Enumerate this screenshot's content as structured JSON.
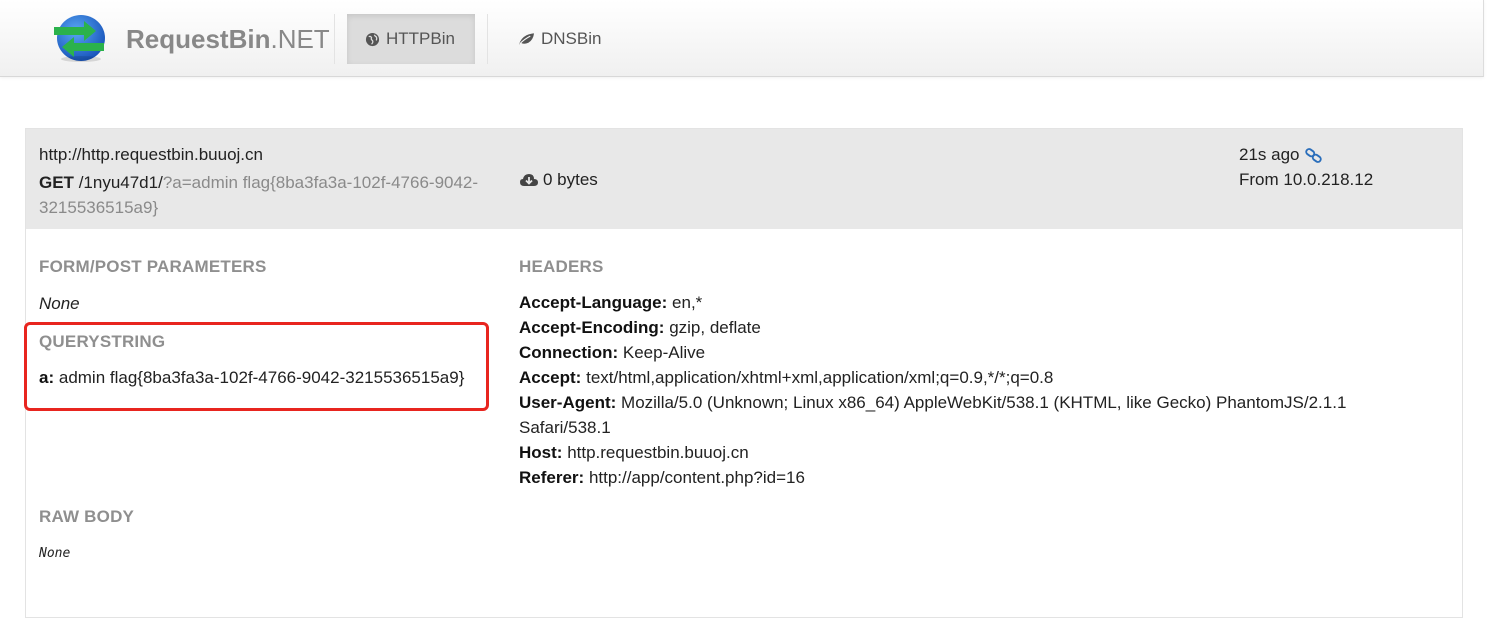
{
  "navbar": {
    "brand_bold": "RequestBin",
    "brand_suffix": ".NET",
    "nav_items": [
      {
        "label": "HTTPBin",
        "icon": "globe-icon",
        "active": true
      },
      {
        "label": "DNSBin",
        "icon": "leaf-icon",
        "active": false
      }
    ]
  },
  "request": {
    "host_url": "http://http.requestbin.buuoj.cn",
    "method": "GET",
    "path": "/1nyu47d1/",
    "query": "?a=admin flag{8ba3fa3a-102f-4766-9042-3215536515a9}",
    "size": "0 bytes",
    "time_ago": "21s ago",
    "from": "From 10.0.218.12"
  },
  "form_params": {
    "title": "FORM/POST PARAMETERS",
    "value": "None"
  },
  "querystring": {
    "title": "QUERYSTRING",
    "key": "a:",
    "value": "admin flag{8ba3fa3a-102f-4766-9042-3215536515a9}"
  },
  "headers": {
    "title": "HEADERS",
    "items": [
      {
        "name": "Accept-Language:",
        "value": "en,*"
      },
      {
        "name": "Accept-Encoding:",
        "value": "gzip, deflate"
      },
      {
        "name": "Connection:",
        "value": "Keep-Alive"
      },
      {
        "name": "Accept:",
        "value": "text/html,application/xhtml+xml,application/xml;q=0.9,*/*;q=0.8"
      },
      {
        "name": "User-Agent:",
        "value": "Mozilla/5.0 (Unknown; Linux x86_64) AppleWebKit/538.1 (KHTML, like Gecko) PhantomJS/2.1.1 Safari/538.1"
      },
      {
        "name": "Host:",
        "value": "http.requestbin.buuoj.cn"
      },
      {
        "name": "Referer:",
        "value": "http://app/content.php?id=16"
      }
    ]
  },
  "raw_body": {
    "title": "RAW BODY",
    "value": "None"
  },
  "colors": {
    "highlight": "#e8251f",
    "link_icon": "#2a6ebb",
    "logo_blue": "#1f6fd0",
    "logo_green": "#2bb24c"
  }
}
